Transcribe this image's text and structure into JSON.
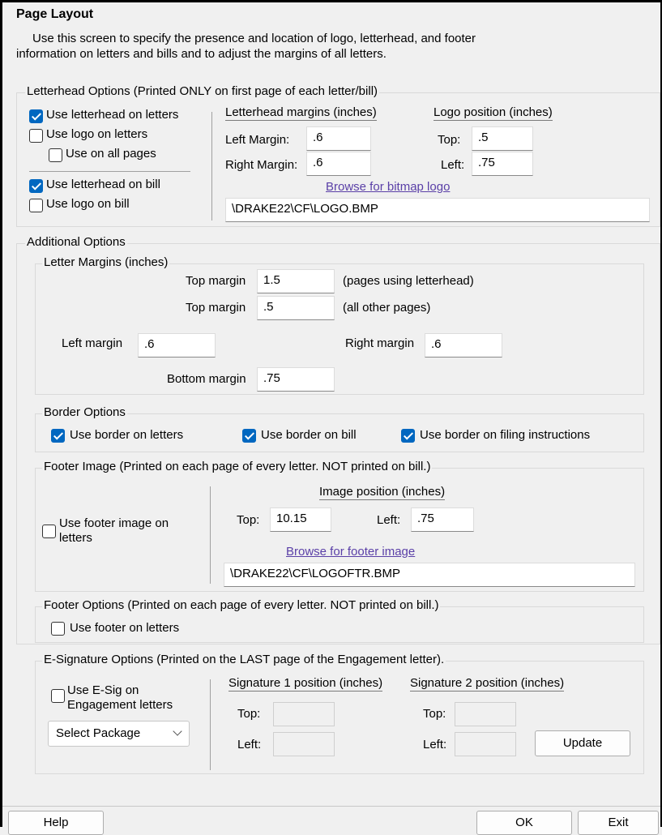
{
  "header": {
    "title": "Page Layout",
    "desc_line1": "Use this screen to specify the presence and location of logo, letterhead, and footer",
    "desc_line2": "information on letters and bills and to adjust the margins of all letters."
  },
  "letterhead": {
    "legend": "Letterhead Options (Printed ONLY on first page of each letter/bill)",
    "use_letterhead_letters": {
      "label": "Use letterhead on letters",
      "checked": true
    },
    "use_logo_letters": {
      "label": "Use logo on letters",
      "checked": false
    },
    "use_all_pages": {
      "label": "Use on all pages",
      "checked": false
    },
    "use_letterhead_bill": {
      "label": "Use letterhead on bill",
      "checked": true
    },
    "use_logo_bill": {
      "label": "Use logo on bill",
      "checked": false
    },
    "margins_header": "Letterhead margins (inches)",
    "left_margin_label": "Left Margin:",
    "left_margin_value": ".6",
    "right_margin_label": "Right Margin:",
    "right_margin_value": ".6",
    "logo_header": "Logo position (inches)",
    "top_label": "Top:",
    "top_value": ".5",
    "left_label": "Left:",
    "left_value": ".75",
    "browse_link": "Browse for bitmap logo",
    "logo_path": "\\DRAKE22\\CF\\LOGO.BMP"
  },
  "additional": {
    "legend": "Additional Options",
    "letter_margins": {
      "legend": "Letter Margins (inches)",
      "top1_label": "Top margin",
      "top1_value": "1.5",
      "top1_note": "(pages using letterhead)",
      "top2_label": "Top margin",
      "top2_value": ".5",
      "top2_note": "(all other pages)",
      "left_label": "Left margin",
      "left_value": ".6",
      "right_label": "Right margin",
      "right_value": ".6",
      "bottom_label": "Bottom margin",
      "bottom_value": ".75"
    },
    "border": {
      "legend": "Border Options",
      "letters": {
        "label": "Use border on letters",
        "checked": true
      },
      "bill": {
        "label": "Use border on bill",
        "checked": true
      },
      "filing": {
        "label": "Use border on filing instructions",
        "checked": true
      }
    },
    "footer_image": {
      "legend": "Footer Image (Printed on each page of every letter. NOT printed on bill.)",
      "use_label_line1": "Use footer image on",
      "use_label_line2": "letters",
      "checked": false,
      "position_header": "Image position (inches)",
      "top_label": "Top:",
      "top_value": "10.15",
      "left_label": "Left:",
      "left_value": ".75",
      "browse_link": "Browse for footer image",
      "path": "\\DRAKE22\\CF\\LOGOFTR.BMP"
    },
    "footer_options": {
      "legend": "Footer Options (Printed on each page of every letter. NOT printed on bill.)",
      "use_footer": {
        "label": "Use footer on letters",
        "checked": false
      }
    },
    "esig": {
      "legend": "E-Signature Options (Printed on the LAST page of the Engagement letter).",
      "use_label_line1": "Use E-Sig on",
      "use_label_line2": "Engagement letters",
      "checked": false,
      "package_select": "Select Package",
      "sig1_header": "Signature 1 position (inches)",
      "sig2_header": "Signature 2 position (inches)",
      "top_label": "Top:",
      "left_label": "Left:",
      "update_button": "Update"
    }
  },
  "footer_buttons": {
    "help": "Help",
    "ok": "OK",
    "exit": "Exit"
  },
  "colors": {
    "checkbox_checked": "#0067c0",
    "link": "#5a3fa7",
    "background": "#f0f0f0"
  }
}
